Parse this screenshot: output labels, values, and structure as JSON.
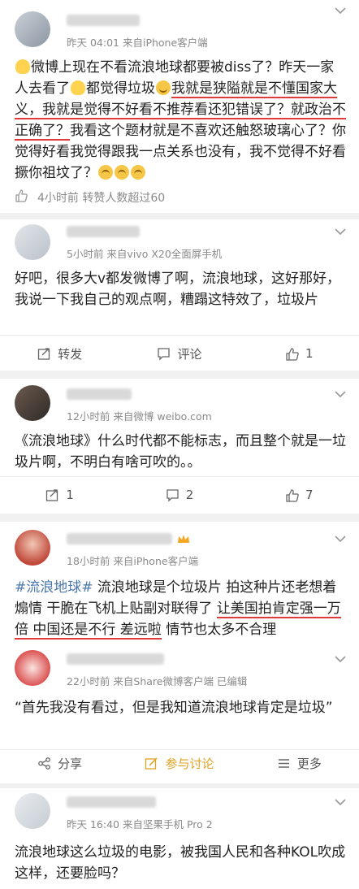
{
  "post1": {
    "meta": "昨天 04:01  来自iPhone客户端",
    "line1_pre": "微博上现在不看流浪地球都要被diss了？昨天一家人去看了",
    "line1_mid": "都觉得垃圾",
    "underlined": "我就是狭隘就是不懂国家大义，我就是觉得不好看不推荐看还犯错误了？就政治不正确了？",
    "tail": "我看这个题材就是不喜欢还触怒玻璃心了？你觉得好看我觉得跟我一点关系也没有，我不觉得不好看撅你祖坟了？",
    "stats": "4小时前  转赞人数超过60"
  },
  "post2": {
    "meta": "5小时前  来自vivo X20全面屏手机",
    "text": "好吧，很多大v都发微博了啊，流浪地球，这好那好，我说一下我自己的观点啊，糟蹋这特效了，垃圾片",
    "repost": "转发",
    "comment": "评论",
    "like": "1"
  },
  "post3": {
    "meta": "12小时前  来自微博 weibo.com",
    "text": "《流浪地球》什么时代都不能标志，而且整个就是一垃圾片啊，不明白有啥可吹的。。",
    "repost": "1",
    "comment": "2",
    "like": "7"
  },
  "post4": {
    "meta": "18小时前  来自iPhone客户端",
    "tag": "#流浪地球#",
    "text_a": " 流浪地球是个垃圾片 拍这种片还老想着煽情 干脆在飞机上贴副对联得了 ",
    "text_ul1": "让美国拍肯定强一万倍 中国还是不行 差远啦",
    "text_b": " 情节也太多不合理"
  },
  "post5": {
    "meta": "22小时前  来自Share微博客户端  已编辑",
    "text": "“首先我没有看过，但是我知道流浪地球肯定是垃圾”",
    "share": "分享",
    "discuss": "参与讨论",
    "more": "更多"
  },
  "post6": {
    "meta": "昨天 16:40  来自坚果手机 Pro 2",
    "text": "流浪地球这么垃圾的电影，被我国人民和各种KOL吹成这样，还要脸吗？"
  }
}
